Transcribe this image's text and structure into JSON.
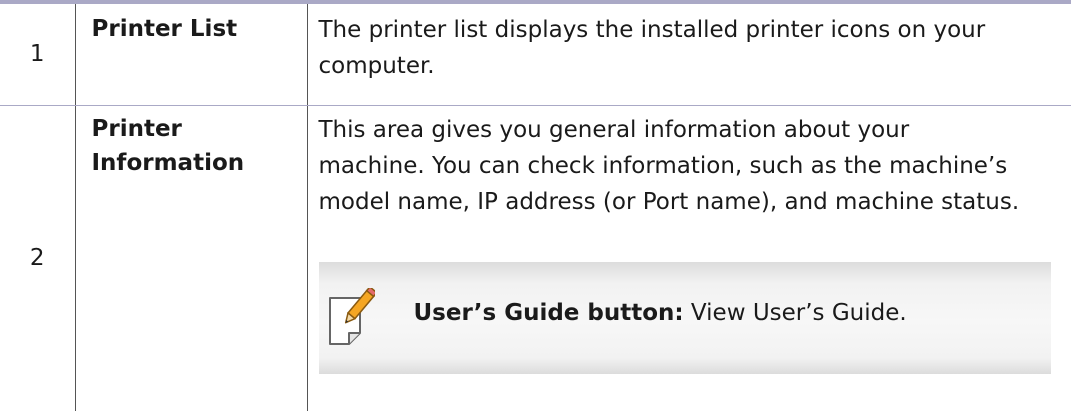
{
  "rows": [
    {
      "number": "1",
      "term": "Printer List",
      "description": "The printer list displays the installed printer icons on your computer."
    },
    {
      "number": "2",
      "term": "Printer Information",
      "description_line1": "This area gives you general information about your",
      "description_line2": "machine. You can check information, such as the machine’s",
      "description_line3": "model name, IP address (or Port name), and machine status.",
      "note": {
        "icon": "note-pencil-icon",
        "bold_label": "User’s Guide button:",
        "text": " View User’s Guide."
      }
    }
  ],
  "colors": {
    "rule": "#aaa9c6",
    "note_background": "#f2f2f2",
    "pencil_accent": "#f5a623"
  }
}
